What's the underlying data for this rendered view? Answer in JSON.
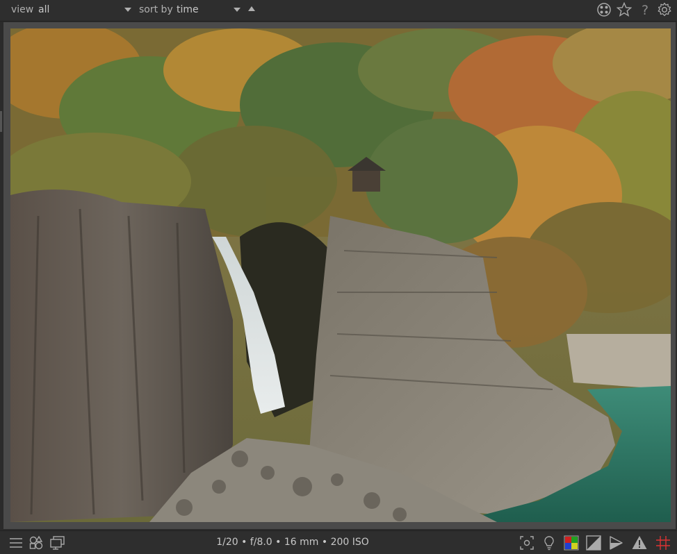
{
  "topbar": {
    "view_label": "view",
    "view_value": "all",
    "sort_label": "sort by",
    "sort_value": "time"
  },
  "icons": {
    "presets": "presets-icon",
    "star": "star-icon",
    "help": "help-icon",
    "settings": "gear-icon",
    "menu": "hamburger-menu-icon",
    "styles": "styles-icon",
    "display": "display-icon",
    "focus_peaking": "focus-peaking-icon",
    "bulb": "lightbulb-icon",
    "color_assessment": "color-assessment-icon",
    "raw_overexposed": "raw-overexposed-icon",
    "soft_proof": "soft-proof-icon",
    "gamut_warning": "gamut-warning-icon",
    "guides": "guides-icon"
  },
  "statusbar": {
    "exif": "1/20 • f/8.0 • 16 mm • 200 ISO"
  },
  "colors": {
    "panel_bg": "#2e2e2e",
    "frame_bg": "#4a4a4a",
    "text": "#b8b8b8",
    "guides_red": "#d33"
  }
}
